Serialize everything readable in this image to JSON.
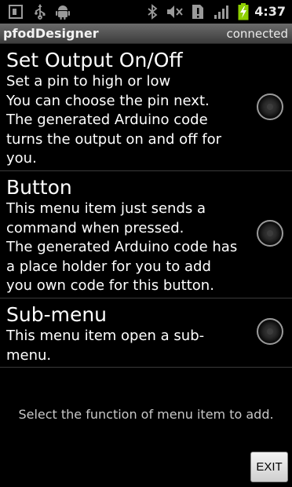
{
  "status_bar": {
    "time": "4:37",
    "left_icons": [
      "screen-icon",
      "usb-icon",
      "android-icon"
    ],
    "right_icons": [
      "bluetooth-icon",
      "mute-icon",
      "alert-icon",
      "signal-icon",
      "battery-charging-icon"
    ]
  },
  "title_bar": {
    "app_name": "pfodDesigner",
    "connection_status": "connected"
  },
  "menu_items": [
    {
      "title": "Set Output On/Off",
      "desc_lines": [
        "Set a pin to high or low",
        "You can choose the pin next.",
        "The generated Arduino code",
        "turns the output on and off for",
        "you."
      ]
    },
    {
      "title": "Button",
      "desc_lines": [
        "This menu item just sends a",
        "command when pressed.",
        "The generated Arduino code has",
        "a place holder for you to add",
        "you own code for this button."
      ]
    },
    {
      "title": "Sub-menu",
      "desc_lines": [
        "This menu item open a sub-",
        "menu."
      ]
    }
  ],
  "footer": {
    "instruction": "Select the function of menu item to add."
  },
  "exit_button": {
    "label": "EXIT"
  },
  "colors": {
    "background": "#000000",
    "title_bar": "#555555",
    "battery": "#8ed000"
  }
}
